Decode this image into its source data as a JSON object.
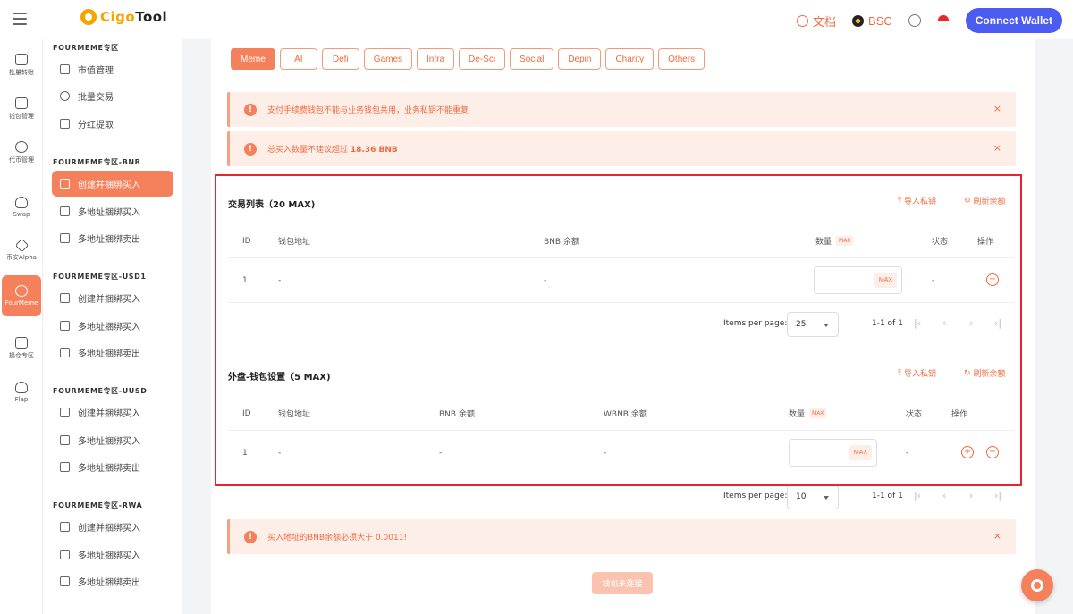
{
  "header": {
    "logo_text_a": "Cigo",
    "logo_text_b": "Tool",
    "docs_label": "文档",
    "chain_label": "BSC",
    "connect_label": "Connect Wallet"
  },
  "rail": [
    {
      "label": "批量转账",
      "icon": "transfer-icon"
    },
    {
      "label": "钱包管理",
      "icon": "wallet-icon"
    },
    {
      "label": "代币管理",
      "icon": "token-icon"
    },
    {
      "label": "Swap",
      "icon": "swap-icon"
    },
    {
      "label": "币安Alpha",
      "icon": "binance-icon"
    },
    {
      "label": "FourMeme",
      "icon": "fourmeme-icon"
    },
    {
      "label": "换仓专区",
      "icon": "stack-icon"
    },
    {
      "label": "Flap",
      "icon": "butterfly-icon"
    }
  ],
  "nav": {
    "group1": "FOURMEME专区",
    "group1_items": [
      "市值管理",
      "批量交易",
      "分红提取"
    ],
    "group2": "FOURMEME专区-BNB",
    "group2_items": [
      "创建并捆绑买入",
      "多地址捆绑买入",
      "多地址捆绑卖出"
    ],
    "group3": "FOURMEME专区-USD1",
    "group3_items": [
      "创建并捆绑买入",
      "多地址捆绑买入",
      "多地址捆绑卖出"
    ],
    "group4": "FOURMEME专区-UUSD",
    "group4_items": [
      "创建并捆绑买入",
      "多地址捆绑买入",
      "多地址捆绑卖出"
    ],
    "group5": "FOURMEME专区-RWA",
    "group5_items": [
      "创建并捆绑买入",
      "多地址捆绑买入",
      "多地址捆绑卖出"
    ]
  },
  "categories": [
    "Meme",
    "AI",
    "Defi",
    "Games",
    "Infra",
    "De-Sci",
    "Social",
    "Depin",
    "Charity",
    "Others"
  ],
  "alerts": {
    "a1": "支付手续费钱包不能与业务钱包共用，业务私钥不能重复",
    "a2_prefix": "总买入数量不建议超过 ",
    "a2_value": "18.36 BNB",
    "a3": "买入地址的BNB余额必须大于 0.0011!",
    "close": "×",
    "info": "!"
  },
  "tx_section": {
    "title": "交易列表（20 MAX)",
    "import_label": "导入私钥",
    "refresh_label": "刷新余额",
    "headers": {
      "id": "ID",
      "address": "钱包地址",
      "bnb": "BNB 余额",
      "qty": "数量",
      "max": "MAX",
      "status": "状态",
      "op": "操作"
    },
    "row": {
      "id": "1",
      "address": "-",
      "bnb": "-",
      "status": "-",
      "max": "MAX"
    },
    "pager": {
      "label": "Items per page:",
      "size": "25",
      "range": "1-1 of 1"
    }
  },
  "ext_section": {
    "title": "外盘-钱包设置（5 MAX)",
    "import_label": "导入私钥",
    "refresh_label": "刷新余额",
    "headers": {
      "id": "ID",
      "address": "钱包地址",
      "bnb": "BNB 余额",
      "wbnb": "WBNB 余额",
      "qty": "数量",
      "max": "MAX",
      "status": "状态",
      "op": "操作"
    },
    "row": {
      "id": "1",
      "address": "-",
      "bnb": "-",
      "wbnb": "-",
      "status": "-",
      "max": "MAX"
    },
    "pager": {
      "label": "Items per page:",
      "size": "10",
      "range": "1-1 of 1"
    }
  },
  "pager_nav": {
    "first": "|‹",
    "prev": "‹",
    "next": "›",
    "last": "›|"
  },
  "bottom_button": "钱包未连接",
  "colors": {
    "accent": "#f4815c",
    "connect": "#4c5cf0",
    "highlight": "#e8242c"
  }
}
